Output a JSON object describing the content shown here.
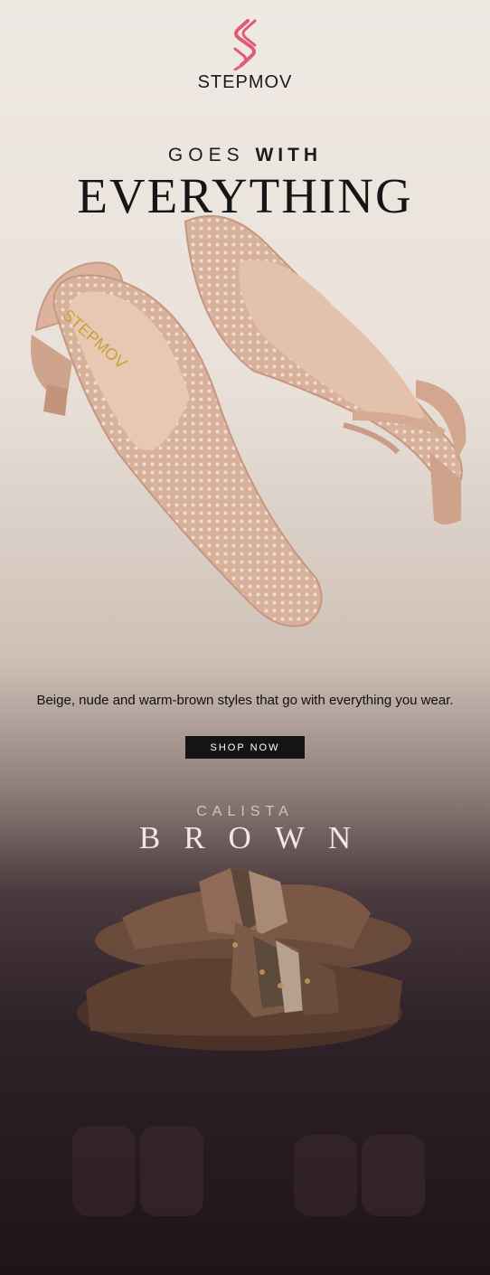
{
  "brand": {
    "name": "STEPMOV",
    "logo_color": "#e05b73"
  },
  "hero": {
    "headline_pre": "GOES",
    "headline_bold": "WITH",
    "headline_main": "EVERYTHING",
    "insole_logo_text": "STEPMOV",
    "tagline": "Beige, nude and warm-brown styles that go with everything you wear.",
    "cta_label": "SHOP NOW"
  },
  "product": {
    "subtitle": "CALISTA",
    "title": "BROWN"
  }
}
